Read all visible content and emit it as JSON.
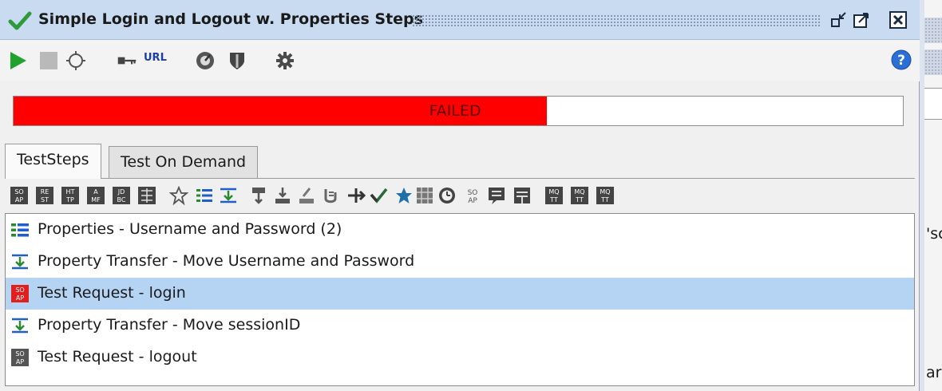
{
  "window": {
    "title": "Simple Login and Logout w. Properties Steps",
    "status_icon": "green-checkmark-icon",
    "controls": [
      "minimize-icon",
      "maximize-icon",
      "close-icon"
    ]
  },
  "toolbar": {
    "items": [
      "run-icon",
      "stop-icon",
      "options-icon",
      "credentials-icon",
      "url-icon",
      "load-test-icon",
      "security-test-icon",
      "settings-icon"
    ],
    "url_label": "URL",
    "help": "help-icon"
  },
  "progress": {
    "status": "FAILED",
    "fraction": 0.6,
    "color": "#ff0000"
  },
  "tabs": [
    {
      "label": "TestSteps",
      "active": true
    },
    {
      "label": "Test On Demand",
      "active": false
    }
  ],
  "step_toolbar": {
    "icons": [
      "soap-request-icon",
      "rest-request-icon",
      "http-request-icon",
      "amf-request-icon",
      "jdbc-request-icon",
      "mock-response-icon",
      "groovy-script-icon",
      "properties-icon",
      "property-transfer-icon",
      "conditional-goto-icon",
      "delay-icon",
      "run-testcase-icon",
      "manual-step-icon",
      "send-mqtt-icon",
      "assertion-icon",
      "receive-icon",
      "event-icon",
      "data-source-icon",
      "clock-icon",
      "soap-mock-icon",
      "message-icon",
      "mqtt-publish-icon",
      "mqtt-drop-icon",
      "mqtt-receive-icon"
    ]
  },
  "steps": [
    {
      "label": "Properties - Username and Password (2)",
      "icon": "properties-icon",
      "selected": false
    },
    {
      "label": "Property Transfer - Move Username and Password",
      "icon": "property-transfer-icon",
      "selected": false
    },
    {
      "label": "Test Request - login",
      "icon": "soap-request-failed-icon",
      "selected": true
    },
    {
      "label": "Property Transfer - Move sessionID",
      "icon": "property-transfer-icon",
      "selected": false
    },
    {
      "label": "Test Request - logout",
      "icon": "soap-request-icon",
      "selected": false
    }
  ],
  "side_fragments": {
    "top": "'sc",
    "bottom": "ar"
  }
}
